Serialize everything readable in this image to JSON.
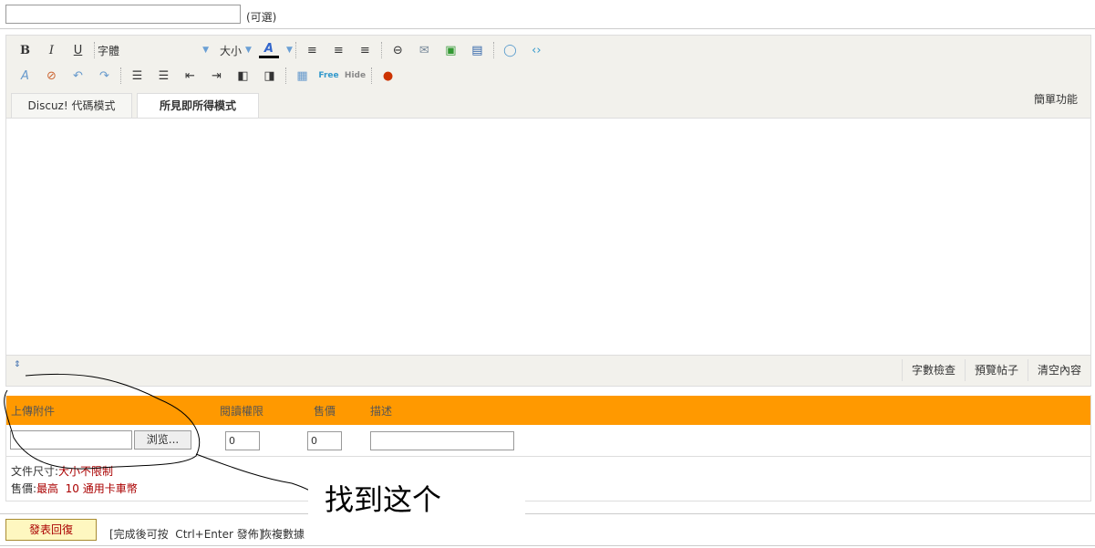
{
  "title_field": {
    "value": "",
    "optional_label": "(可選)"
  },
  "toolbar": {
    "row1": [
      "B",
      "I",
      "U"
    ],
    "font_label": "字體",
    "size_label": "大小",
    "color_label": "A",
    "row2_extra": [
      "Free",
      "Hide"
    ]
  },
  "tabs": [
    {
      "label": "Discuz! 代碼模式"
    },
    {
      "label": "所見即所得模式",
      "active": true
    }
  ],
  "simple_mode": "簡單功能",
  "editor_footer": [
    "字數檢查",
    "預覽帖子",
    "清空內容"
  ],
  "attachments": {
    "headers": [
      "上傳附件",
      "閱讀權限",
      "售價",
      "描述"
    ],
    "browse_label": "浏览...",
    "read_perm": "0",
    "price": "0",
    "description": "",
    "file_size_label": "文件尺寸:",
    "file_size_value": "大小不限制",
    "price_label": "售價:",
    "price_value": "最高  10 通用卡車幣"
  },
  "annotation": "找到这个",
  "submit": {
    "label": "發表回復",
    "hint": "[完成後可按  Ctrl+Enter 發佈]",
    "restore": "恢複數據"
  },
  "colors": {
    "orange": "#ff9900",
    "red": "#aa0000"
  }
}
